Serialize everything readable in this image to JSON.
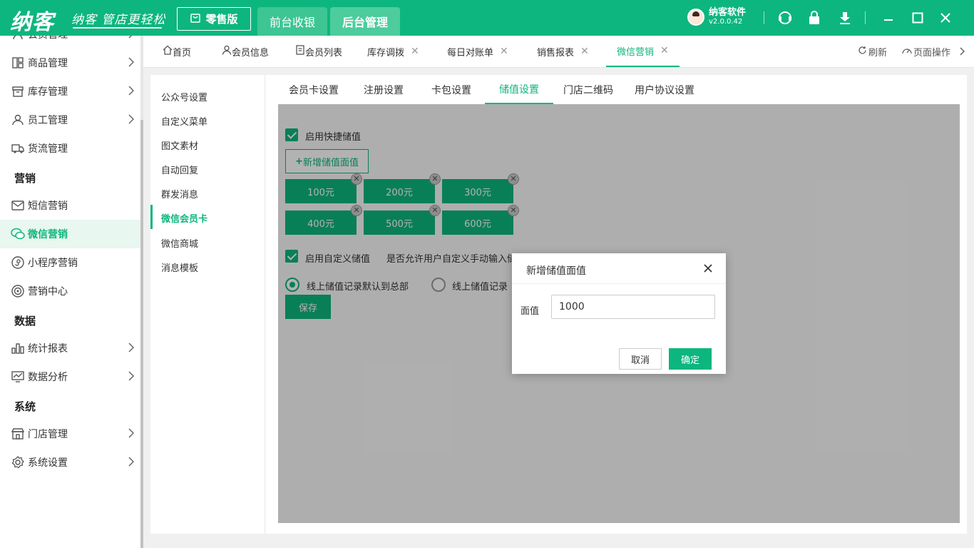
{
  "header": {
    "logo": "纳客",
    "slogan": "纳客 管店更轻松",
    "edition": "零售版",
    "nav_tabs": [
      "前台收银",
      "后台管理"
    ],
    "user_name": "纳客软件",
    "version": "v2.0.0.42",
    "accent_color": "#0db67e"
  },
  "sidebar": {
    "items": [
      {
        "label": "会员管理",
        "icon": "member-icon"
      },
      {
        "label": "商品管理",
        "icon": "goods-icon"
      },
      {
        "label": "库存管理",
        "icon": "inventory-icon"
      },
      {
        "label": "员工管理",
        "icon": "staff-icon"
      },
      {
        "label": "货流管理",
        "icon": "logistics-icon"
      },
      {
        "label": "短信营销",
        "icon": "sms-icon"
      },
      {
        "label": "微信营销",
        "icon": "wechat-icon"
      },
      {
        "label": "小程序营销",
        "icon": "miniprogram-icon"
      },
      {
        "label": "营销中心",
        "icon": "target-icon"
      },
      {
        "label": "统计报表",
        "icon": "chart-icon"
      },
      {
        "label": "数据分析",
        "icon": "analysis-icon"
      },
      {
        "label": "门店管理",
        "icon": "store-icon"
      },
      {
        "label": "系统设置",
        "icon": "gear-icon"
      }
    ],
    "sections": [
      "营销",
      "数据",
      "系统"
    ]
  },
  "page_tabs": [
    {
      "label": "首页"
    },
    {
      "label": "会员信息"
    },
    {
      "label": "会员列表"
    },
    {
      "label": "库存调拨"
    },
    {
      "label": "每日对账单"
    },
    {
      "label": "销售报表"
    },
    {
      "label": "微信营销"
    }
  ],
  "tab_actions": {
    "refresh": "刷新",
    "page_ops": "页面操作"
  },
  "submenu": [
    "公众号设置",
    "自定义菜单",
    "图文素材",
    "自动回复",
    "群发消息",
    "微信会员卡",
    "微信商城",
    "消息模板"
  ],
  "settings_tabs": [
    "会员卡设置",
    "注册设置",
    "卡包设置",
    "储值设置",
    "门店二维码",
    "用户协议设置"
  ],
  "stored_value": {
    "quick_label": "启用快捷储值",
    "add_button": "新增储值面值",
    "amounts": [
      "100元",
      "200元",
      "300元",
      "400元",
      "500元",
      "600元"
    ],
    "custom_label": "启用自定义储值",
    "custom_desc": "是否允许用户自定义手动输入储值金额",
    "radio_options": [
      "线上储值记录默认到总部",
      "线上储值记录"
    ],
    "save": "保存"
  },
  "dialog": {
    "title": "新增储值面值",
    "field_label": "面值",
    "field_value": "1000",
    "cancel": "取消",
    "confirm": "确定"
  }
}
